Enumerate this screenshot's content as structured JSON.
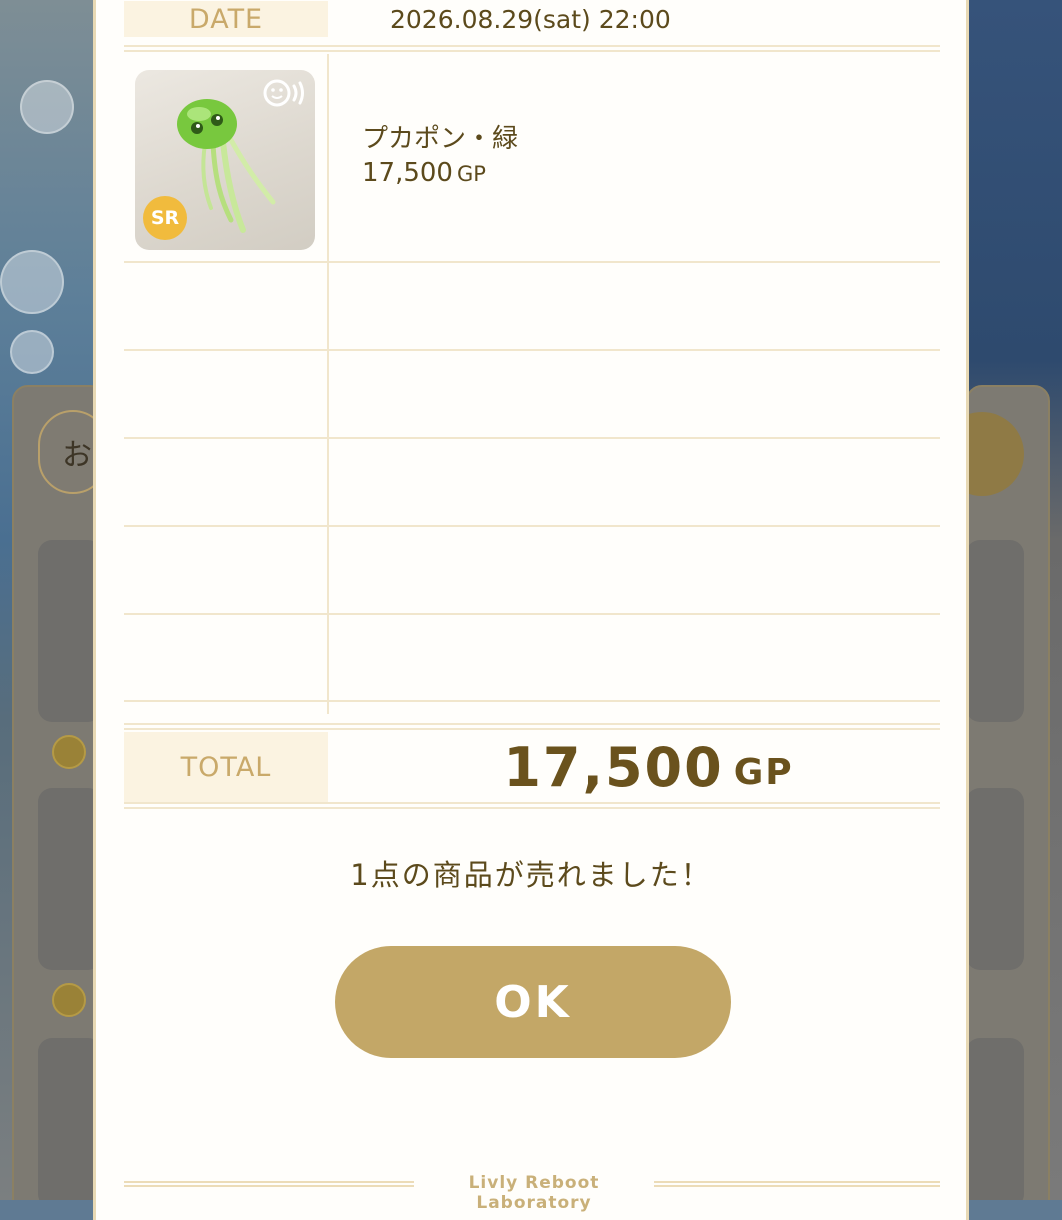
{
  "receipt": {
    "date_label": "DATE",
    "date_value": "2026.08.29(sat) 22:00",
    "item": {
      "name": "プカポン・緑",
      "price": "17,500",
      "unit": "GP",
      "rarity": "SR",
      "icon": "green-jellyfish-item"
    },
    "total_label": "TOTAL",
    "total_value": "17,500",
    "total_unit": "GP"
  },
  "message": "1点の商品が売れました！",
  "ok_button": "OK",
  "footer": "Livly Reboot Laboratory",
  "background": {
    "search_partial": "お"
  },
  "colors": {
    "accent": "#c3a767",
    "label_bg": "#fbf3e1",
    "text": "#5c4a1c",
    "rarity": "#f1bb3d"
  }
}
